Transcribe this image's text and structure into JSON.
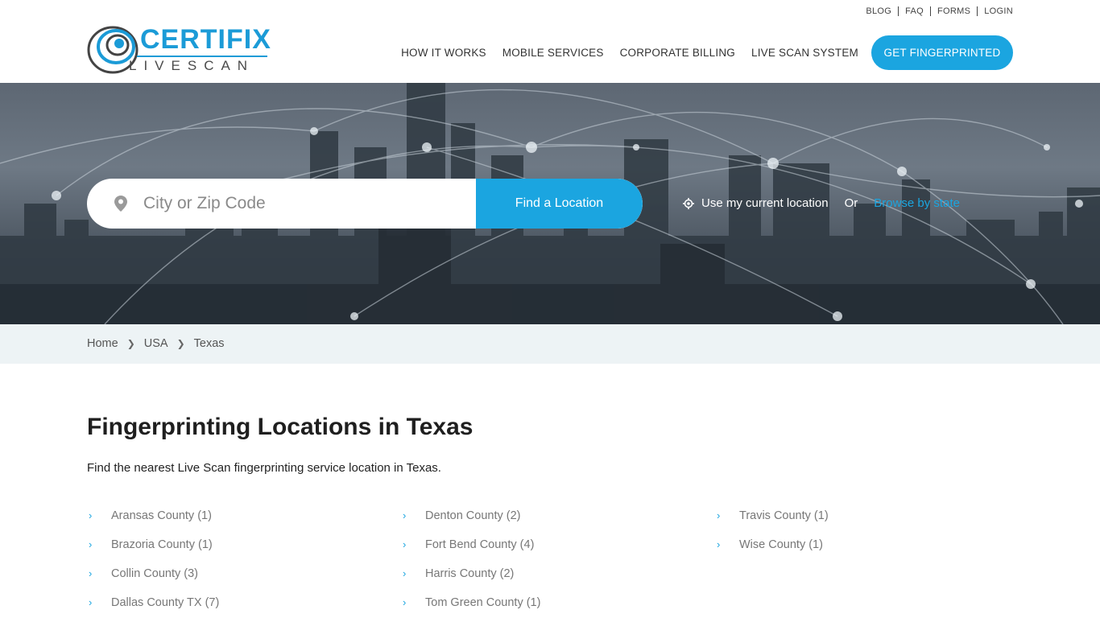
{
  "brand": {
    "name_main": "CERTIFIX",
    "name_sub": "LIVESCAN",
    "accent": "#1ba5e0"
  },
  "toplinks": [
    "BLOG",
    "FAQ",
    "FORMS",
    "LOGIN"
  ],
  "nav": {
    "items": [
      "HOW IT WORKS",
      "MOBILE SERVICES",
      "CORPORATE BILLING",
      "LIVE SCAN SYSTEM"
    ],
    "cta": "GET FINGERPRINTED"
  },
  "search": {
    "placeholder": "City or Zip Code",
    "button": "Find a Location",
    "use_location": "Use my current location",
    "or": "Or",
    "browse": "Browse by state"
  },
  "breadcrumb": [
    "Home",
    "USA",
    "Texas"
  ],
  "content": {
    "title": "Fingerprinting Locations in Texas",
    "intro": "Find the nearest Live Scan fingerprinting service location in Texas."
  },
  "counties": {
    "col1": [
      "Aransas County (1)",
      "Brazoria County (1)",
      "Collin County (3)",
      "Dallas County TX (7)"
    ],
    "col2": [
      "Denton County (2)",
      "Fort Bend County (4)",
      "Harris County (2)",
      "Tom Green County (1)"
    ],
    "col3": [
      "Travis County (1)",
      "Wise County (1)"
    ]
  }
}
